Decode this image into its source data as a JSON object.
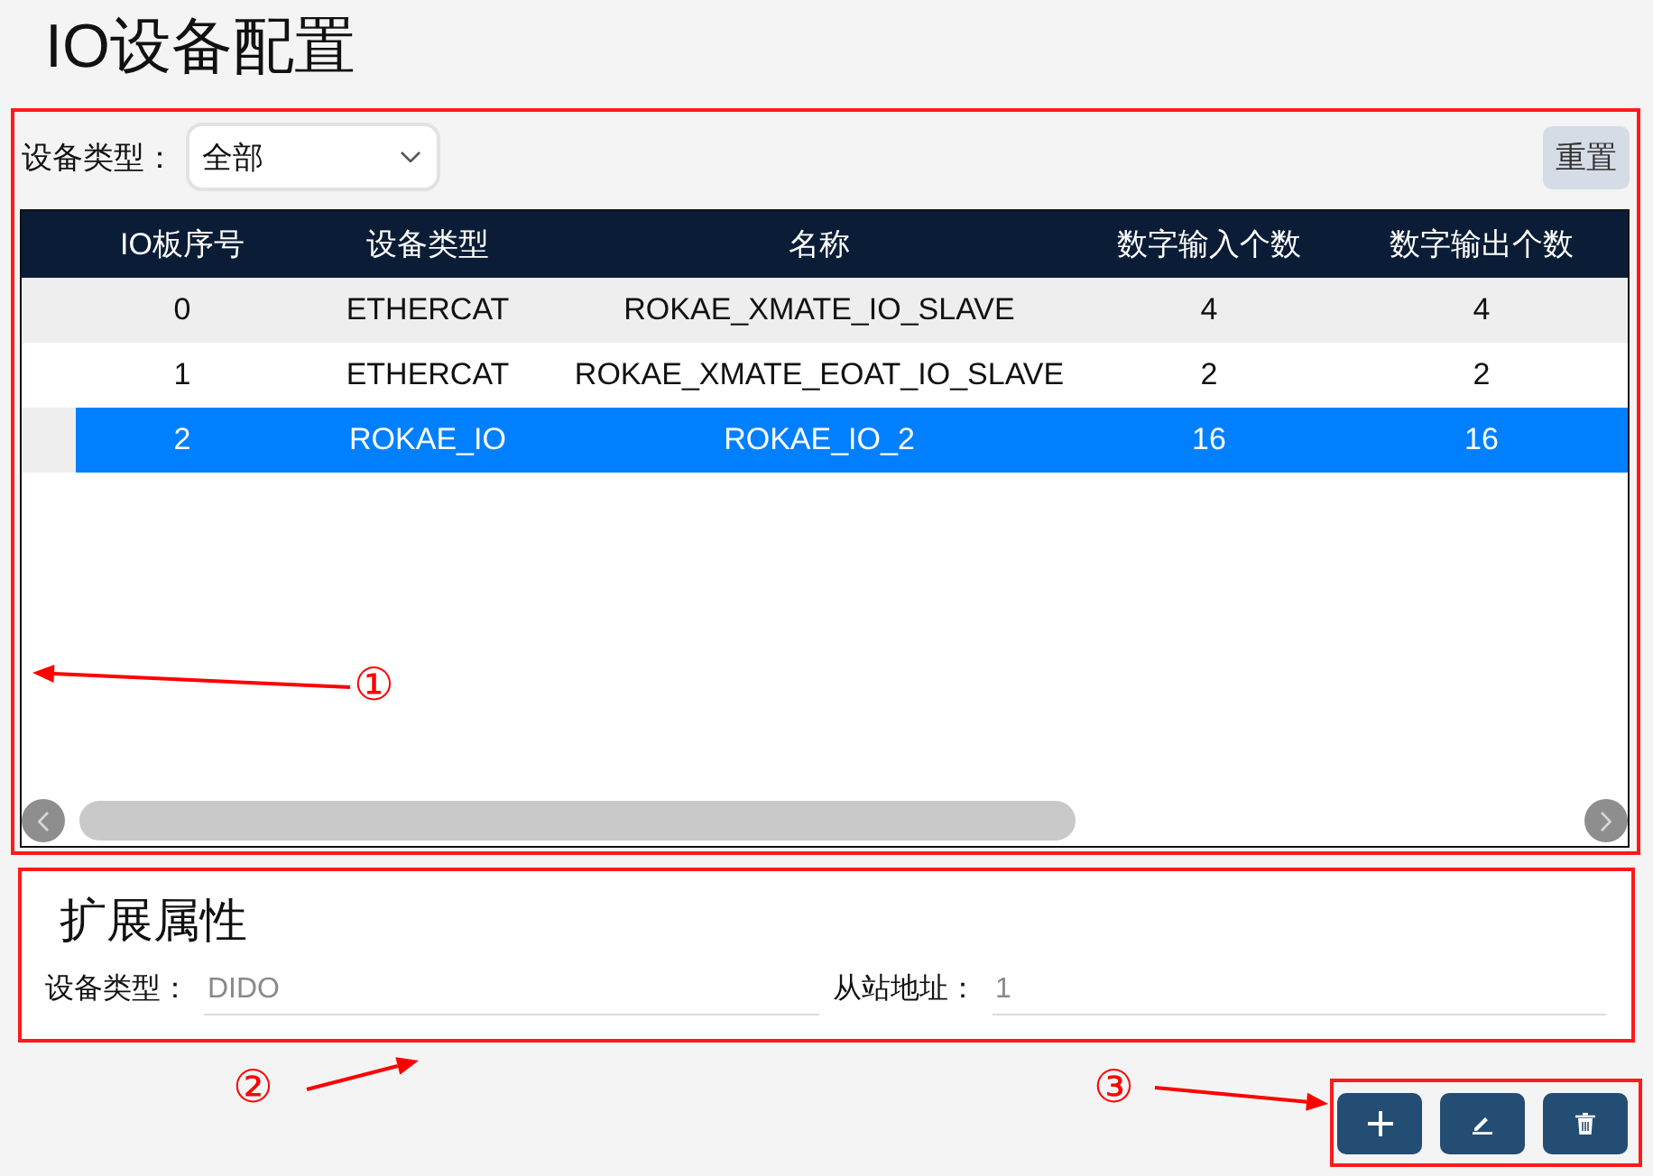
{
  "page": {
    "title": "IO设备配置"
  },
  "filter": {
    "label": "设备类型：",
    "value": "全部",
    "reset": "重置"
  },
  "table": {
    "columns": [
      "IO板序号",
      "设备类型",
      "名称",
      "数字输入个数",
      "数字输出个数"
    ],
    "rows": [
      {
        "cells": [
          "0",
          "ETHERCAT",
          "ROKAE_XMATE_IO_SLAVE",
          "4",
          "4"
        ],
        "selected": false
      },
      {
        "cells": [
          "1",
          "ETHERCAT",
          "ROKAE_XMATE_EOAT_IO_SLAVE",
          "2",
          "2"
        ],
        "selected": false
      },
      {
        "cells": [
          "2",
          "ROKAE_IO",
          "ROKAE_IO_2",
          "16",
          "16"
        ],
        "selected": true
      }
    ]
  },
  "extended": {
    "title": "扩展属性",
    "fields": [
      {
        "label": "设备类型：",
        "value": "DIDO",
        "disabled": true
      },
      {
        "label": "从站地址：",
        "value": "1",
        "disabled": true
      }
    ]
  },
  "actions": [
    {
      "kind": "add"
    },
    {
      "kind": "edit"
    },
    {
      "kind": "delete"
    }
  ],
  "annotations": [
    {
      "label": "①"
    },
    {
      "label": "②"
    },
    {
      "label": "③"
    }
  ]
}
